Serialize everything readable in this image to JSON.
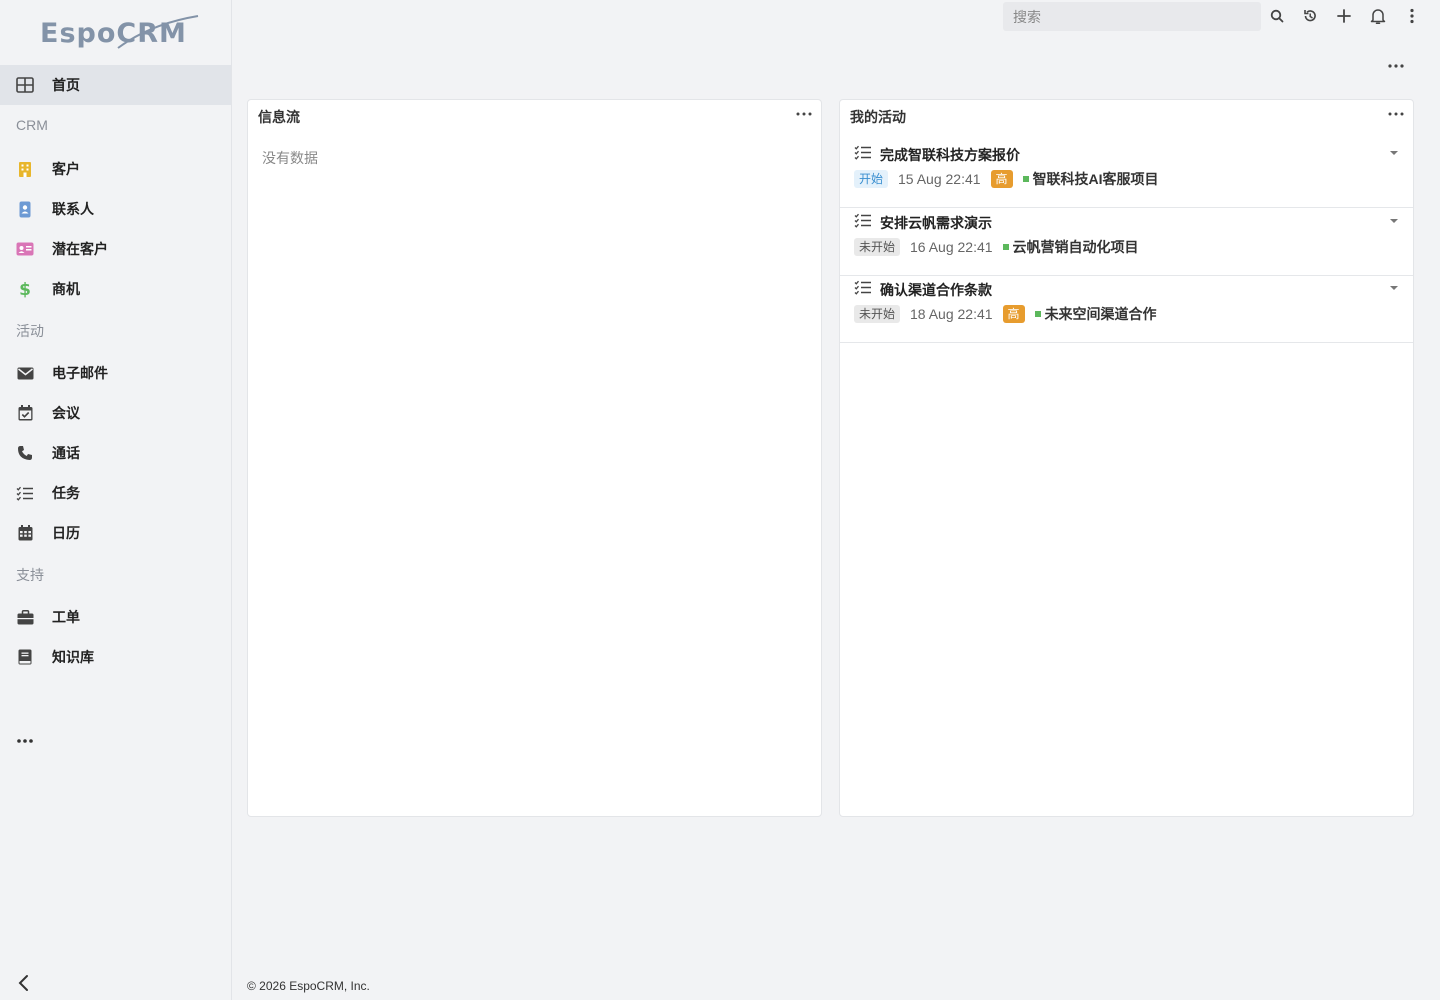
{
  "sidebar": {
    "logo_text": "EspoCRM",
    "items": [
      {
        "type": "item",
        "label": "首页",
        "icon": "dashboard-icon",
        "active": true
      },
      {
        "type": "group",
        "label": "CRM"
      },
      {
        "type": "item",
        "label": "客户",
        "icon": "building-icon",
        "color": "#e8b62c"
      },
      {
        "type": "item",
        "label": "联系人",
        "icon": "contact-icon",
        "color": "#6d9ad4"
      },
      {
        "type": "item",
        "label": "潜在客户",
        "icon": "id-card-icon",
        "color": "#d975b6"
      },
      {
        "type": "item",
        "label": "商机",
        "icon": "dollar-icon",
        "color": "#5cb85c"
      },
      {
        "type": "group",
        "label": "活动"
      },
      {
        "type": "item",
        "label": "电子邮件",
        "icon": "envelope-icon"
      },
      {
        "type": "item",
        "label": "会议",
        "icon": "calendar-check-icon"
      },
      {
        "type": "item",
        "label": "通话",
        "icon": "phone-icon"
      },
      {
        "type": "item",
        "label": "任务",
        "icon": "task-list-icon"
      },
      {
        "type": "item",
        "label": "日历",
        "icon": "calendar-icon"
      },
      {
        "type": "group",
        "label": "支持"
      },
      {
        "type": "item",
        "label": "工单",
        "icon": "briefcase-icon"
      },
      {
        "type": "item",
        "label": "知识库",
        "icon": "book-icon"
      }
    ]
  },
  "header": {
    "search_placeholder": "搜索",
    "icons": [
      "search-icon",
      "history-icon",
      "plus-icon",
      "bell-icon",
      "kebab-menu-icon"
    ]
  },
  "dashlets": {
    "stream": {
      "title": "信息流",
      "empty_text": "没有数据"
    },
    "activities": {
      "title": "我的活动",
      "items": [
        {
          "name": "完成智联科技方案报价",
          "status": "开始",
          "status_kind": "start",
          "date": "15 Aug 22:41",
          "priority": "高",
          "parent": "智联科技AI客服项目"
        },
        {
          "name": "安排云帆需求演示",
          "status": "未开始",
          "status_kind": "notstart",
          "date": "16 Aug 22:41",
          "priority": "",
          "parent": "云帆营销自动化项目"
        },
        {
          "name": "确认渠道合作条款",
          "status": "未开始",
          "status_kind": "notstart",
          "date": "18 Aug 22:41",
          "priority": "高",
          "parent": "未来空间渠道合作"
        }
      ]
    }
  },
  "footer": {
    "copyright": "© 2026 EspoCRM, Inc."
  },
  "colors": {
    "accent_high": "#e79c2e",
    "status_start_text": "#3a8fd0",
    "parent_dot": "#5cb85c"
  }
}
